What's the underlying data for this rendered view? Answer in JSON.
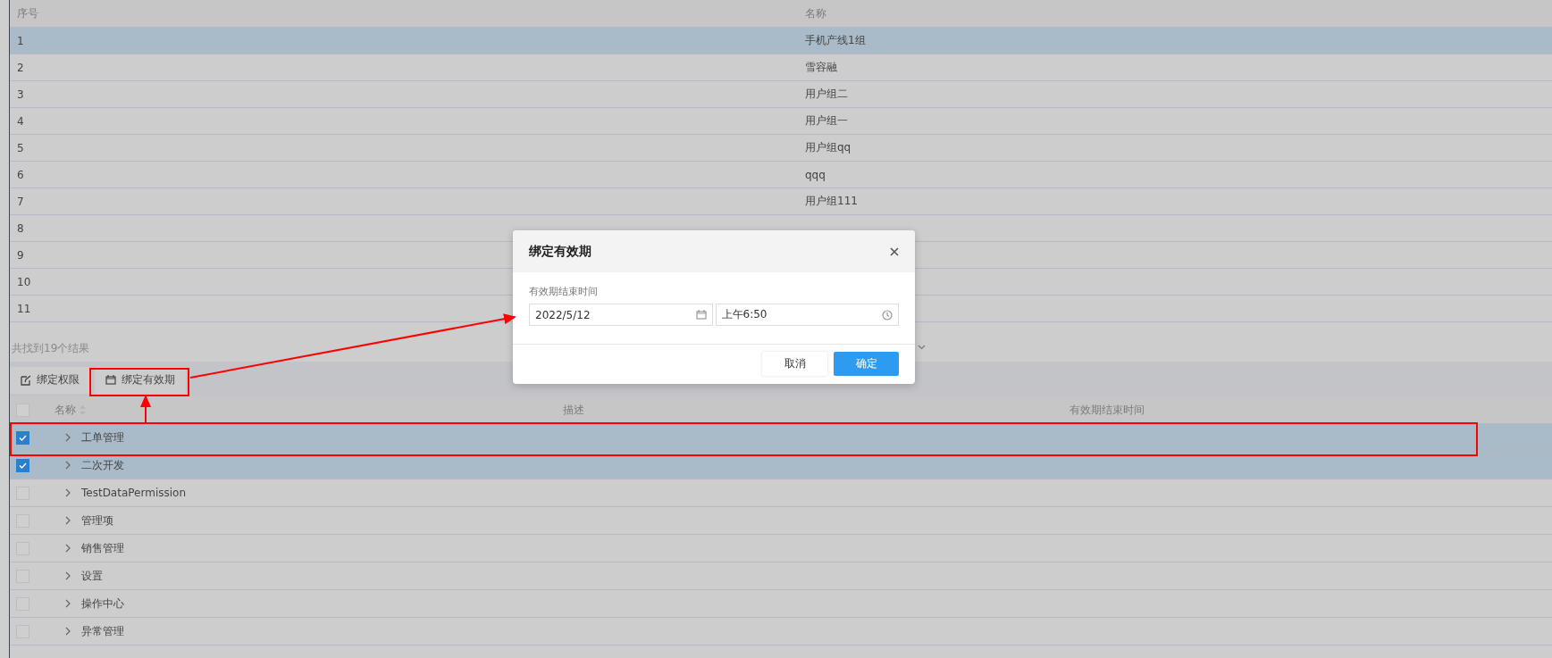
{
  "group_table": {
    "columns": [
      "序号",
      "名称"
    ],
    "rows": [
      {
        "index": "1",
        "name": "手机产线1组",
        "selected": true
      },
      {
        "index": "2",
        "name": "雪容融",
        "selected": false
      },
      {
        "index": "3",
        "name": "用户组二",
        "selected": false
      },
      {
        "index": "4",
        "name": "用户组一",
        "selected": false
      },
      {
        "index": "5",
        "name": "用户组qq",
        "selected": false
      },
      {
        "index": "6",
        "name": "qqq",
        "selected": false
      },
      {
        "index": "7",
        "name": "用户组111",
        "selected": false
      },
      {
        "index": "8",
        "selected": false
      },
      {
        "index": "9",
        "selected": false
      },
      {
        "index": "10",
        "selected": false
      },
      {
        "index": "11",
        "selected": false
      }
    ],
    "result_count": "共找到19个结果"
  },
  "toolbar": {
    "buttons": [
      {
        "label": "绑定权限",
        "kind": "edit"
      },
      {
        "label": "绑定有效期",
        "kind": "calendar"
      }
    ]
  },
  "permission_table": {
    "columns": [
      "名称",
      "描述",
      "有效期结束时间"
    ],
    "all_checked": false,
    "rows": [
      {
        "name": "工单管理",
        "checked": true
      },
      {
        "name": "二次开发",
        "checked": true
      },
      {
        "name": "TestDataPermission",
        "checked": false
      },
      {
        "name": "管理项",
        "checked": false
      },
      {
        "name": "销售管理",
        "checked": false
      },
      {
        "name": "设置",
        "checked": false
      },
      {
        "name": "操作中心",
        "checked": false
      },
      {
        "name": "异常管理",
        "checked": false
      }
    ]
  },
  "dialog": {
    "title": "绑定有效期",
    "field_label": "有效期结束时间",
    "date": "2022/5/12",
    "time": "上午6:50",
    "buttons": [
      {
        "label": "取消",
        "primary": false
      },
      {
        "label": "确定",
        "primary": true
      }
    ]
  }
}
